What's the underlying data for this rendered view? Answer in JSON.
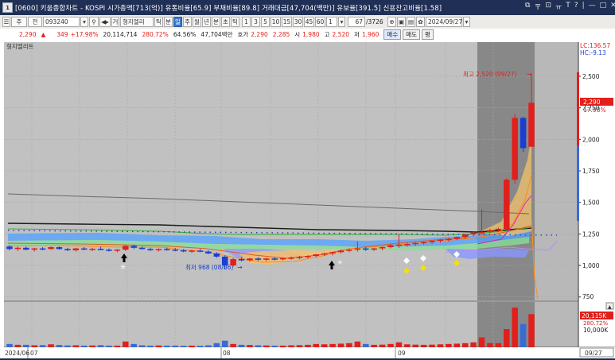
{
  "titlebar": {
    "text": "[0600] 키움종합차트 - KOSPI 시가총액[713(억)] 유통비율[65.9] 부채비율[89.8] 거래대금[47,704(백만)] 유보율[391.5] 신용잔고비율[1.58]",
    "icon": "1",
    "controls": [
      "⧉",
      "〒",
      "⊡",
      "ㅠ",
      "T",
      "?",
      "|",
      "—",
      "□",
      "✕"
    ]
  },
  "toolbar": {
    "market": "주",
    "all": "전",
    "code": "093240",
    "stock_name": "형지엘리",
    "periods": [
      "틱",
      "분",
      "일",
      "주",
      "월",
      "년",
      "분",
      "초",
      "틱"
    ],
    "selected_period": "일",
    "intervals": [
      "1",
      "3",
      "5",
      "10",
      "15",
      "30",
      "45",
      "60"
    ],
    "interval_value": "1",
    "count": "67",
    "total": "/3726",
    "date": "2024/09/27",
    "search_icon": "search-icon",
    "arrow_icon": "nav-arrows-icon"
  },
  "infobar": {
    "price": "2,290",
    "arrow": "▲",
    "change": "349",
    "change_pct": "+17.98%",
    "volume": "20,114,714",
    "vol_ratio": "280.72%",
    "turnover": "64.56%",
    "amount": "47,704백만",
    "ask_label": "호가",
    "ask1": "2,290",
    "ask2": "2,285",
    "open_label": "시",
    "open": "1,980",
    "high_label": "고",
    "high": "2,520",
    "low_label": "저",
    "low": "1,960",
    "buy": "매수",
    "sell": "매도",
    "more": "평"
  },
  "chart": {
    "stock_label": "형지엘리트",
    "lc": "LC:136.57",
    "hc": "HC:-9.13",
    "price_ticks": [
      "2,500",
      "2,250",
      "2,000",
      "1,750",
      "1,500",
      "1,250",
      "1,000",
      "750"
    ],
    "current_price": "2,290",
    "current_pct": "17.98%",
    "high_annotation": "최고 2,520 (09/27)",
    "low_annotation": "최저 968 (08/06)",
    "volume_label": "20,115K",
    "volume_pct": "280.72%",
    "volume_tick": "10,000K",
    "date_labels": [
      "2024/06",
      "07",
      "08",
      "09"
    ],
    "end_date": "09/27"
  },
  "chart_data": {
    "type": "candlestick",
    "ylim": [
      750,
      2600
    ],
    "candles": [
      {
        "o": 1150,
        "h": 1160,
        "l": 1120,
        "c": 1130
      },
      {
        "o": 1130,
        "h": 1150,
        "l": 1115,
        "c": 1140
      },
      {
        "o": 1140,
        "h": 1150,
        "l": 1120,
        "c": 1125
      },
      {
        "o": 1125,
        "h": 1140,
        "l": 1110,
        "c": 1135
      },
      {
        "o": 1135,
        "h": 1145,
        "l": 1120,
        "c": 1130
      },
      {
        "o": 1130,
        "h": 1150,
        "l": 1125,
        "c": 1145
      },
      {
        "o": 1145,
        "h": 1150,
        "l": 1125,
        "c": 1130
      },
      {
        "o": 1130,
        "h": 1140,
        "l": 1115,
        "c": 1120
      },
      {
        "o": 1120,
        "h": 1140,
        "l": 1110,
        "c": 1135
      },
      {
        "o": 1135,
        "h": 1145,
        "l": 1120,
        "c": 1128
      },
      {
        "o": 1128,
        "h": 1140,
        "l": 1115,
        "c": 1132
      },
      {
        "o": 1132,
        "h": 1148,
        "l": 1120,
        "c": 1125
      },
      {
        "o": 1125,
        "h": 1135,
        "l": 1110,
        "c": 1118
      },
      {
        "o": 1118,
        "h": 1130,
        "l": 1105,
        "c": 1125
      },
      {
        "o": 1125,
        "h": 1160,
        "l": 1115,
        "c": 1155
      },
      {
        "o": 1155,
        "h": 1165,
        "l": 1130,
        "c": 1140
      },
      {
        "o": 1140,
        "h": 1150,
        "l": 1125,
        "c": 1130
      },
      {
        "o": 1130,
        "h": 1140,
        "l": 1115,
        "c": 1122
      },
      {
        "o": 1122,
        "h": 1135,
        "l": 1110,
        "c": 1130
      },
      {
        "o": 1130,
        "h": 1142,
        "l": 1118,
        "c": 1126
      },
      {
        "o": 1126,
        "h": 1138,
        "l": 1112,
        "c": 1120
      },
      {
        "o": 1120,
        "h": 1130,
        "l": 1105,
        "c": 1112
      },
      {
        "o": 1112,
        "h": 1125,
        "l": 1100,
        "c": 1118
      },
      {
        "o": 1118,
        "h": 1130,
        "l": 1105,
        "c": 1110
      },
      {
        "o": 1110,
        "h": 1120,
        "l": 1090,
        "c": 1095
      },
      {
        "o": 1095,
        "h": 1105,
        "l": 1060,
        "c": 1070
      },
      {
        "o": 1070,
        "h": 1080,
        "l": 968,
        "c": 1000
      },
      {
        "o": 1000,
        "h": 1060,
        "l": 990,
        "c": 1050
      },
      {
        "o": 1050,
        "h": 1065,
        "l": 1030,
        "c": 1040
      },
      {
        "o": 1040,
        "h": 1060,
        "l": 1030,
        "c": 1055
      },
      {
        "o": 1055,
        "h": 1065,
        "l": 1035,
        "c": 1045
      },
      {
        "o": 1045,
        "h": 1060,
        "l": 1035,
        "c": 1055
      },
      {
        "o": 1055,
        "h": 1065,
        "l": 1040,
        "c": 1048
      },
      {
        "o": 1048,
        "h": 1060,
        "l": 1040,
        "c": 1058
      },
      {
        "o": 1058,
        "h": 1070,
        "l": 1045,
        "c": 1062
      },
      {
        "o": 1062,
        "h": 1075,
        "l": 1050,
        "c": 1068
      },
      {
        "o": 1068,
        "h": 1080,
        "l": 1055,
        "c": 1075
      },
      {
        "o": 1075,
        "h": 1090,
        "l": 1065,
        "c": 1088
      },
      {
        "o": 1088,
        "h": 1100,
        "l": 1075,
        "c": 1095
      },
      {
        "o": 1095,
        "h": 1110,
        "l": 1080,
        "c": 1105
      },
      {
        "o": 1105,
        "h": 1125,
        "l": 1095,
        "c": 1118
      },
      {
        "o": 1118,
        "h": 1135,
        "l": 1105,
        "c": 1125
      },
      {
        "o": 1125,
        "h": 1190,
        "l": 1110,
        "c": 1135
      },
      {
        "o": 1135,
        "h": 1145,
        "l": 1115,
        "c": 1125
      },
      {
        "o": 1125,
        "h": 1140,
        "l": 1115,
        "c": 1135
      },
      {
        "o": 1135,
        "h": 1150,
        "l": 1120,
        "c": 1145
      },
      {
        "o": 1145,
        "h": 1170,
        "l": 1135,
        "c": 1160
      },
      {
        "o": 1160,
        "h": 1250,
        "l": 1140,
        "c": 1165
      },
      {
        "o": 1165,
        "h": 1180,
        "l": 1150,
        "c": 1170
      },
      {
        "o": 1170,
        "h": 1185,
        "l": 1155,
        "c": 1178
      },
      {
        "o": 1178,
        "h": 1190,
        "l": 1165,
        "c": 1185
      },
      {
        "o": 1185,
        "h": 1200,
        "l": 1170,
        "c": 1195
      },
      {
        "o": 1195,
        "h": 1210,
        "l": 1180,
        "c": 1205
      },
      {
        "o": 1205,
        "h": 1220,
        "l": 1190,
        "c": 1210
      },
      {
        "o": 1210,
        "h": 1230,
        "l": 1200,
        "c": 1225
      },
      {
        "o": 1225,
        "h": 1250,
        "l": 1210,
        "c": 1245
      },
      {
        "o": 1245,
        "h": 1270,
        "l": 1230,
        "c": 1260
      },
      {
        "o": 1260,
        "h": 1445,
        "l": 1250,
        "c": 1265
      },
      {
        "o": 1265,
        "h": 1290,
        "l": 1255,
        "c": 1280
      },
      {
        "o": 1280,
        "h": 1300,
        "l": 1265,
        "c": 1290
      },
      {
        "o": 1290,
        "h": 1690,
        "l": 1280,
        "c": 1680
      },
      {
        "o": 1680,
        "h": 2200,
        "l": 1650,
        "c": 2170
      },
      {
        "o": 2170,
        "h": 2180,
        "l": 1900,
        "c": 1930
      },
      {
        "o": 1941,
        "h": 2520,
        "l": 1960,
        "c": 2290
      }
    ],
    "volumes": [
      2,
      1.5,
      1.5,
      1.2,
      1.3,
      1.8,
      1.4,
      1.1,
      1.2,
      1,
      1.1,
      1.3,
      1,
      1,
      3.5,
      2,
      1.2,
      1,
      1.1,
      1,
      1,
      0.9,
      1,
      0.9,
      1.2,
      2.5,
      4,
      2,
      1.5,
      1.4,
      1.2,
      1.1,
      1,
      1,
      1.2,
      1.3,
      1.5,
      2,
      1.8,
      2,
      2.2,
      2.5,
      3.5,
      2,
      1.5,
      1.6,
      2,
      3,
      1.8,
      1.6,
      1.5,
      1.6,
      1.8,
      2,
      2.2,
      2.5,
      3,
      6,
      2.5,
      2.5,
      11,
      24,
      14,
      20
    ]
  }
}
